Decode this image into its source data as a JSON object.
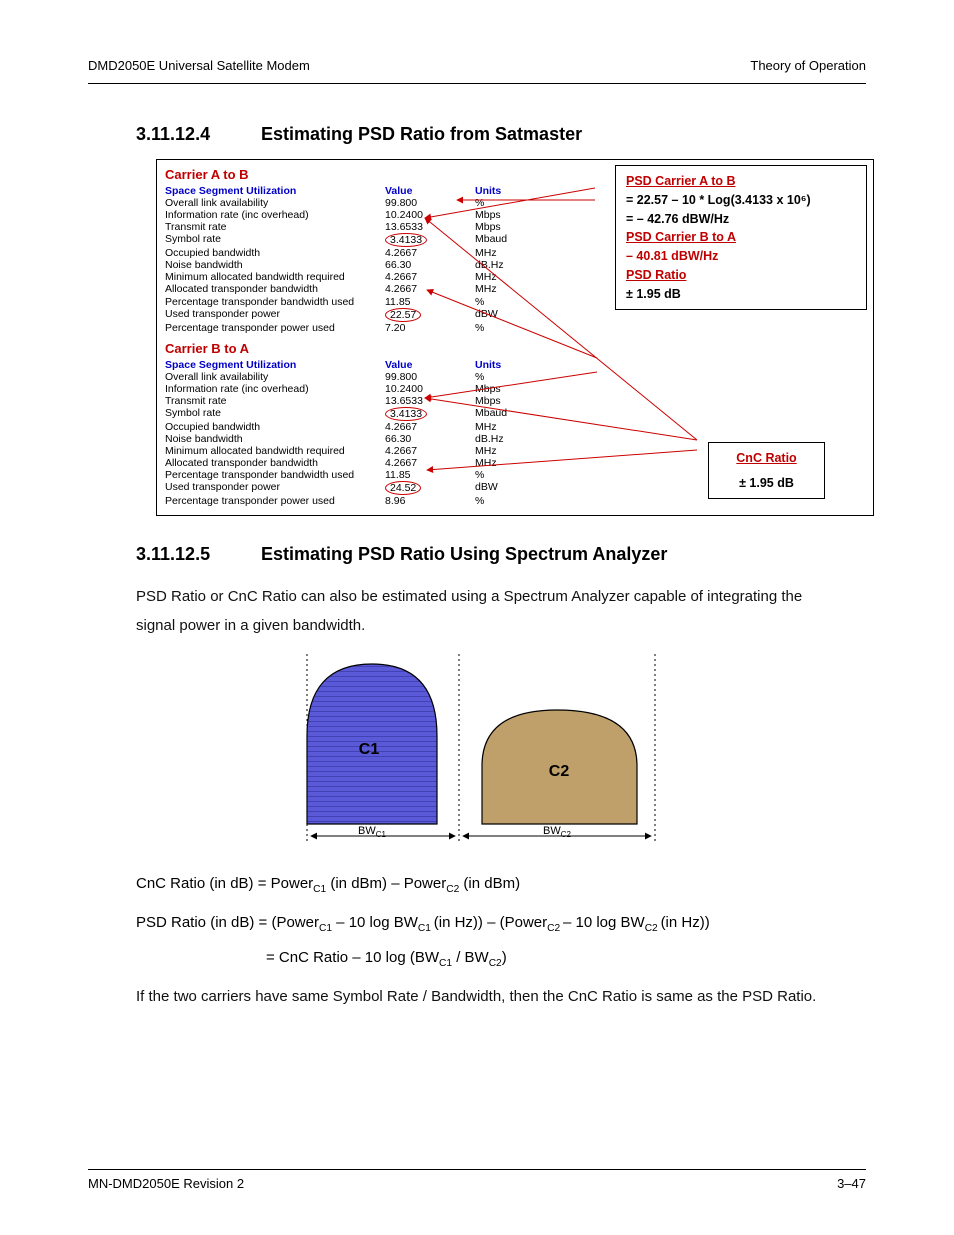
{
  "header": {
    "left": "DMD2050E Universal Satellite Modem",
    "right": "Theory of Operation"
  },
  "sec4": {
    "num": "3.11.12.4",
    "title": "Estimating PSD Ratio from Satmaster"
  },
  "carrierA": {
    "title": "Carrier A to B",
    "head_param": "Space Segment Utilization",
    "head_value": "Value",
    "head_units": "Units",
    "rows": [
      {
        "p": "Overall link availability",
        "v": "99.800",
        "u": "%"
      },
      {
        "p": "Information rate (inc overhead)",
        "v": "10.2400",
        "u": "Mbps"
      },
      {
        "p": "Transmit rate",
        "v": "13.6533",
        "u": "Mbps"
      },
      {
        "p": "Symbol rate",
        "v": "3.4133",
        "u": "Mbaud",
        "circle": true
      },
      {
        "p": "Occupied bandwidth",
        "v": "4.2667",
        "u": "MHz"
      },
      {
        "p": "Noise bandwidth",
        "v": "66.30",
        "u": "dB.Hz"
      },
      {
        "p": "Minimum allocated bandwidth required",
        "v": "4.2667",
        "u": "MHz"
      },
      {
        "p": "Allocated transponder bandwidth",
        "v": "4.2667",
        "u": "MHz"
      },
      {
        "p": "Percentage transponder bandwidth used",
        "v": "11.85",
        "u": "%"
      },
      {
        "p": "Used transponder power",
        "v": "22.57",
        "u": "dBW",
        "circle": true
      },
      {
        "p": "Percentage transponder power used",
        "v": "7.20",
        "u": "%"
      }
    ]
  },
  "carrierB": {
    "title": "Carrier B to A",
    "head_param": "Space Segment Utilization",
    "head_value": "Value",
    "head_units": "Units",
    "rows": [
      {
        "p": "Overall link availability",
        "v": "99.800",
        "u": "%"
      },
      {
        "p": "Information rate (inc overhead)",
        "v": "10.2400",
        "u": "Mbps"
      },
      {
        "p": "Transmit rate",
        "v": "13.6533",
        "u": "Mbps"
      },
      {
        "p": "Symbol rate",
        "v": "3.4133",
        "u": "Mbaud",
        "circle": true
      },
      {
        "p": "Occupied bandwidth",
        "v": "4.2667",
        "u": "MHz"
      },
      {
        "p": "Noise bandwidth",
        "v": "66.30",
        "u": "dB.Hz"
      },
      {
        "p": "Minimum allocated bandwidth required",
        "v": "4.2667",
        "u": "MHz"
      },
      {
        "p": "Allocated transponder bandwidth",
        "v": "4.2667",
        "u": "MHz"
      },
      {
        "p": "Percentage transponder bandwidth used",
        "v": "11.85",
        "u": "%"
      },
      {
        "p": "Used transponder power",
        "v": "24.52",
        "u": "dBW",
        "circle": true
      },
      {
        "p": "Percentage transponder power used",
        "v": "8.96",
        "u": "%"
      }
    ]
  },
  "callout_psd": {
    "l1": "PSD Carrier A to B",
    "l2": "= 22.57 – 10 * Log(3.4133 x 10⁶)",
    "l3": "= – 42.76 dBW/Hz",
    "l4": "PSD Carrier B to A",
    "l5": "– 40.81 dBW/Hz",
    "l6": "PSD Ratio",
    "l7": "± 1.95 dB"
  },
  "callout_cnc": {
    "l1": "CnC Ratio",
    "l2": "± 1.95 dB"
  },
  "sec5": {
    "num": "3.11.12.5",
    "title": "Estimating PSD Ratio Using Spectrum Analyzer"
  },
  "para1": "PSD Ratio or CnC Ratio can also be estimated using a Spectrum Analyzer capable of integrating the signal power in a given bandwidth.",
  "spectrum": {
    "c1": "C1",
    "c2": "C2",
    "bw1": "BW",
    "bw1s": "C1",
    "bw2": "BW",
    "bw2s": "C2"
  },
  "eq1_pre": "CnC Ratio (in dB) = Power",
  "eq1_s1": "C1",
  "eq1_mid": " (in dBm) – Power",
  "eq1_s2": "C2",
  "eq1_end": " (in dBm)",
  "eq2_pre": "PSD Ratio (in dB) = (Power",
  "eq2_s1": "C1",
  "eq2_m1": " – 10 log BW",
  "eq2_s2": "C1 ",
  "eq2_m2": "(in Hz)) – (Power",
  "eq2_s3": "C2 ",
  "eq2_m3": "– 10 log BW",
  "eq2_s4": "C2 ",
  "eq2_end": "(in Hz))",
  "eq3_pre": "= CnC Ratio – 10 log (BW",
  "eq3_s1": "C1",
  "eq3_mid": "  / BW",
  "eq3_s2": "C2",
  "eq3_end": ")",
  "para2": "If the two carriers have same Symbol Rate / Bandwidth, then the CnC Ratio is same as the PSD Ratio.",
  "footer": {
    "left": "MN-DMD2050E    Revision 2",
    "right": "3–47"
  }
}
